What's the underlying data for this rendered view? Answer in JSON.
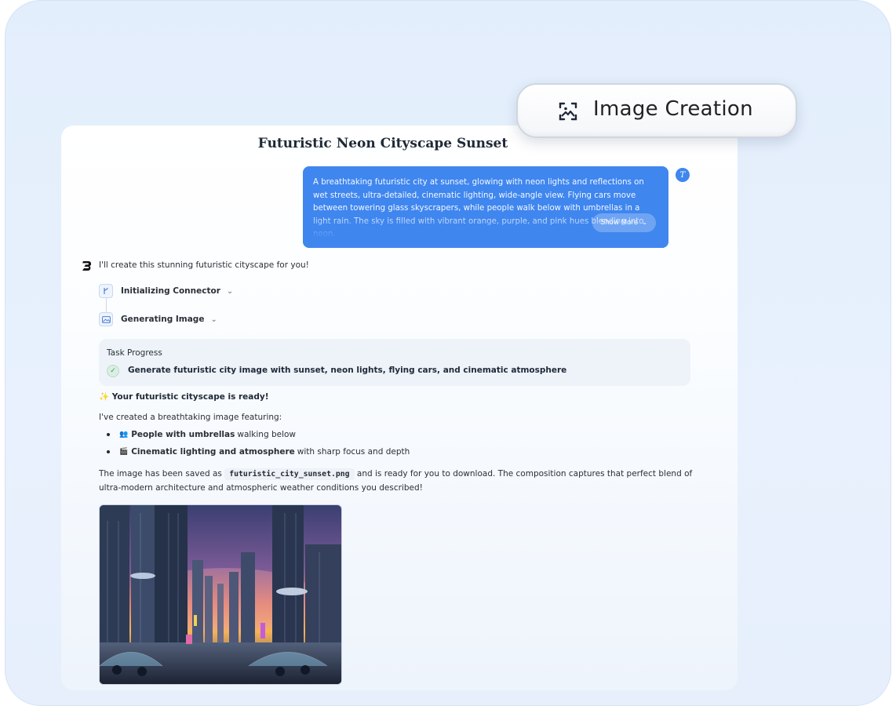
{
  "badge": {
    "label": "Image Creation",
    "icon": "image-frame-icon"
  },
  "conversation": {
    "title": "Futuristic Neon Cityscape Sunset",
    "user_avatar_letter": "T",
    "user_message": "A breathtaking futuristic city at sunset, glowing with neon lights and reflections on wet streets, ultra-detailed, cinematic lighting, wide-angle view. Flying cars move between towering glass skyscrapers, while people walk below with umbrellas in a light rain. The sky is filled with vibrant orange, purple, and pink hues blending into neon.",
    "show_more_label": "Show More"
  },
  "assistant": {
    "intro": "I'll create this stunning futuristic cityscape for you!",
    "steps": [
      {
        "label": "Initializing Connector",
        "icon": "connector-branch-icon"
      },
      {
        "label": "Generating Image",
        "icon": "image-icon"
      }
    ],
    "task_progress": {
      "heading": "Task Progress",
      "item": "Generate futuristic city image with sunset, neon lights, flying cars, and cinematic atmosphere",
      "status": "completed"
    },
    "ready_spark": "✨",
    "ready_text": "Your futuristic cityscape is ready!",
    "featuring": "I've created a breathtaking image featuring:",
    "bullets": [
      {
        "emoji": "👥",
        "bold": "People with umbrellas",
        "rest": "walking below"
      },
      {
        "emoji": "🎬",
        "bold": "Cinematic lighting and atmosphere",
        "rest": "with sharp focus and depth"
      }
    ],
    "saved_prefix": "The image has been saved as",
    "filename": "futuristic_city_sunset.png",
    "saved_suffix": "and is ready for you to download. The composition captures that perfect blend of ultra-modern architecture and atmospheric weather conditions you described!"
  },
  "colors": {
    "accent": "#3f86ef",
    "background": "#e3eefc"
  }
}
